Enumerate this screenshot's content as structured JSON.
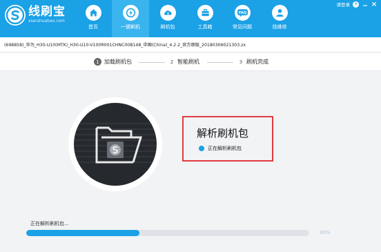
{
  "app": {
    "title": "线刷宝",
    "subtitle": "xianshuabao.com",
    "brand_color": "#1aa1e6"
  },
  "top_right": {
    "login": "请登录",
    "help_icon": "help-icon",
    "minimize_icon": "minimize-icon",
    "close_icon": "close-icon"
  },
  "nav": {
    "items": [
      {
        "label": "首页",
        "icon": "home-icon",
        "active": false
      },
      {
        "label": "一键刷机",
        "icon": "flash-icon",
        "active": true
      },
      {
        "label": "刷机包",
        "icon": "download-icon",
        "active": false
      },
      {
        "label": "工具箱",
        "icon": "toolbox-icon",
        "active": false
      },
      {
        "label": "常见问题",
        "icon": "faq-icon",
        "active": false
      },
      {
        "label": "找维修",
        "icon": "repair-person-icon",
        "active": false
      }
    ]
  },
  "file": {
    "name": "(698858)_华为_H30-U10(MTK)_H30-U10-V100R001CHNC00B148_中国(China)_4.2.2_官方原版_20180306021303.zx"
  },
  "steps": [
    {
      "number": "1",
      "label": "加载刷机包",
      "active": true
    },
    {
      "number": "2",
      "label": "智能刷机",
      "active": false
    },
    {
      "number": "3",
      "label": "刷机完成",
      "active": false
    }
  ],
  "status": {
    "title": "解析刷机包",
    "detail": "正在解析刷机包",
    "highlight_color": "#e0393e"
  },
  "progress": {
    "label": "正在解析刷机包...",
    "percent_text": "40%",
    "fraction": 0.4
  }
}
